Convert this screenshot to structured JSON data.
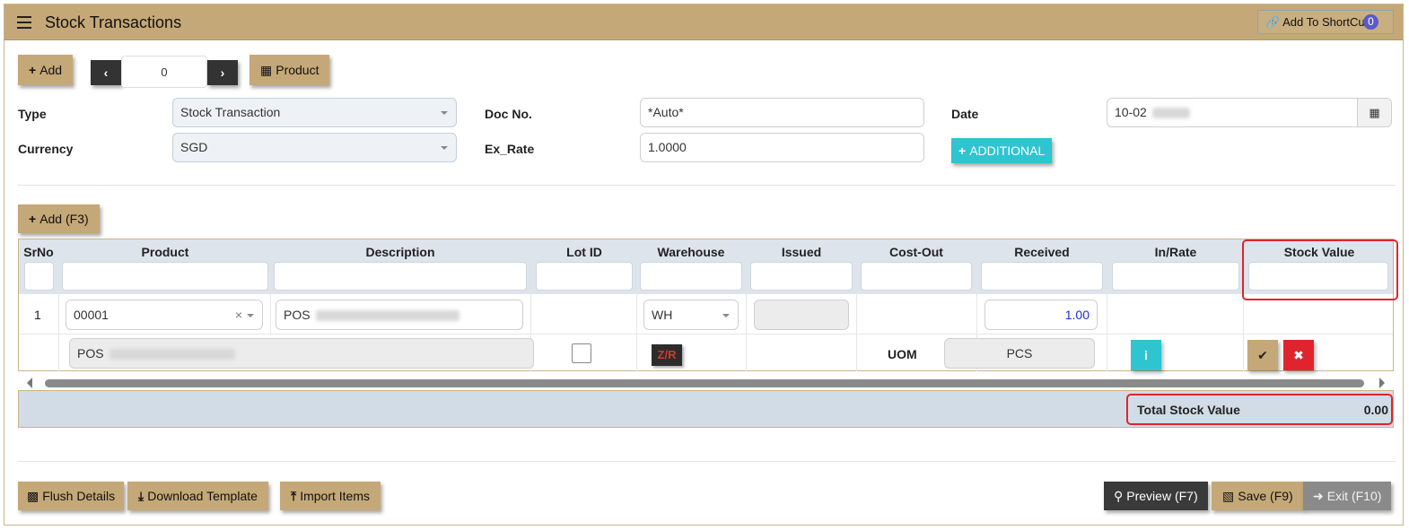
{
  "header": {
    "title": "Stock Transactions",
    "shortcut_label": "Add To ShortCut",
    "shortcut_count": "0"
  },
  "toolbar": {
    "add_label": "Add",
    "record_number": "0",
    "product_label": "Product"
  },
  "form": {
    "type_label": "Type",
    "type_value": "Stock Transaction",
    "currency_label": "Currency",
    "currency_value": "SGD",
    "docno_label": "Doc No.",
    "docno_value": "*Auto*",
    "exrate_label": "Ex_Rate",
    "exrate_value": "1.0000",
    "date_label": "Date",
    "date_value": "10-02",
    "additional_label": "ADDITIONAL"
  },
  "grid": {
    "add_row_label": "Add (F3)",
    "columns": [
      "SrNo",
      "Product",
      "Description",
      "Lot ID",
      "Warehouse",
      "Issued",
      "Cost-Out",
      "Received",
      "In/Rate",
      "Stock Value"
    ],
    "row": {
      "srno": "1",
      "product": "00001",
      "description": "POS",
      "warehouse": "WH",
      "received": "1.00",
      "sub_description": "POS",
      "zr_label": "Z/R",
      "uom_label": "UOM",
      "uom_value": "PCS"
    },
    "total_label": "Total Stock Value",
    "total_value": "0.00"
  },
  "footer": {
    "flush_label": "Flush Details",
    "download_label": "Download Template",
    "import_label": "Import Items",
    "preview_label": "Preview (F7)",
    "save_label": "Save (F9)",
    "exit_label": "Exit (F10)"
  },
  "colors": {
    "titlebar": "#c5a877",
    "button": "#c5a877",
    "accent_teal": "#2ec4d0",
    "danger": "#e0242e"
  }
}
